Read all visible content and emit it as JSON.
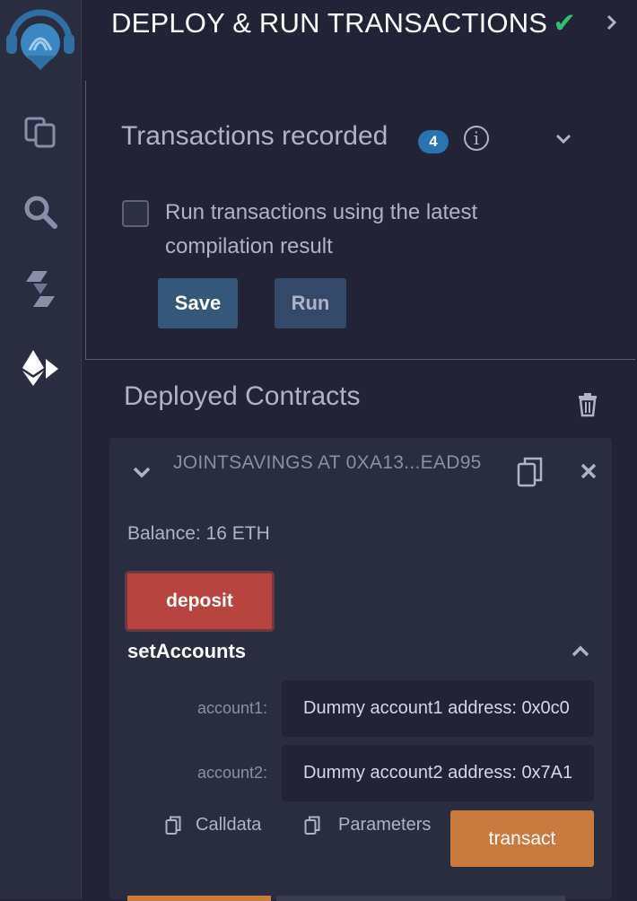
{
  "header": {
    "title": "DEPLOY & RUN TRANSACTIONS"
  },
  "recorder": {
    "title": "Transactions recorded",
    "count": "4",
    "checkbox_label": "Run transactions using the latest compilation result",
    "save_label": "Save",
    "run_label": "Run"
  },
  "deployed": {
    "title": "Deployed Contracts",
    "contract": {
      "title": "JOINTSAVINGS AT 0XA13...EAD95",
      "balance": "Balance: 16 ETH",
      "deposit_label": "deposit",
      "function_name": "setAccounts",
      "params": [
        {
          "label": "account1:",
          "value": "Dummy account1 address: 0x0c0"
        },
        {
          "label": "account2:",
          "value": "Dummy account2 address: 0x7A1"
        }
      ],
      "calldata_label": "Calldata",
      "parameters_label": "Parameters",
      "transact_label": "transact"
    }
  },
  "colors": {
    "accent_check": "#2fbf71",
    "deposit": "#b7443f",
    "transact": "#c97a3f",
    "badge": "#2a73b0"
  },
  "icons": [
    "remix-logo-icon",
    "file-explorer-icon",
    "search-icon",
    "solidity-compiler-icon",
    "deploy-run-icon",
    "check-icon",
    "chevron-right-icon",
    "info-icon",
    "chevron-down-icon",
    "trash-icon",
    "copy-icon",
    "close-icon",
    "chevron-up-icon"
  ]
}
